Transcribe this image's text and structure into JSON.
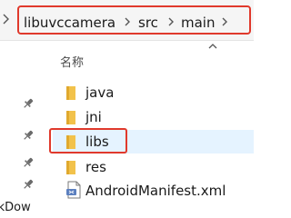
{
  "breadcrumb": {
    "segments": [
      "libuvccamera",
      "src",
      "main"
    ],
    "highlight_color": "#e0392c"
  },
  "list": {
    "column_header": "名称",
    "items": [
      {
        "name": "java",
        "icon": "folder-icon",
        "selected": false
      },
      {
        "name": "jni",
        "icon": "folder-icon",
        "selected": false
      },
      {
        "name": "libs",
        "icon": "folder-icon",
        "selected": true
      },
      {
        "name": "res",
        "icon": "folder-icon",
        "selected": false
      },
      {
        "name": "AndroidManifest.xml",
        "icon": "xml-file-icon",
        "selected": false
      }
    ]
  },
  "nav": {
    "fragment_text": "lkDow"
  },
  "colors": {
    "folder": "#f2c24b",
    "selection": "#e5f3ff",
    "accent": "#e0392c"
  }
}
